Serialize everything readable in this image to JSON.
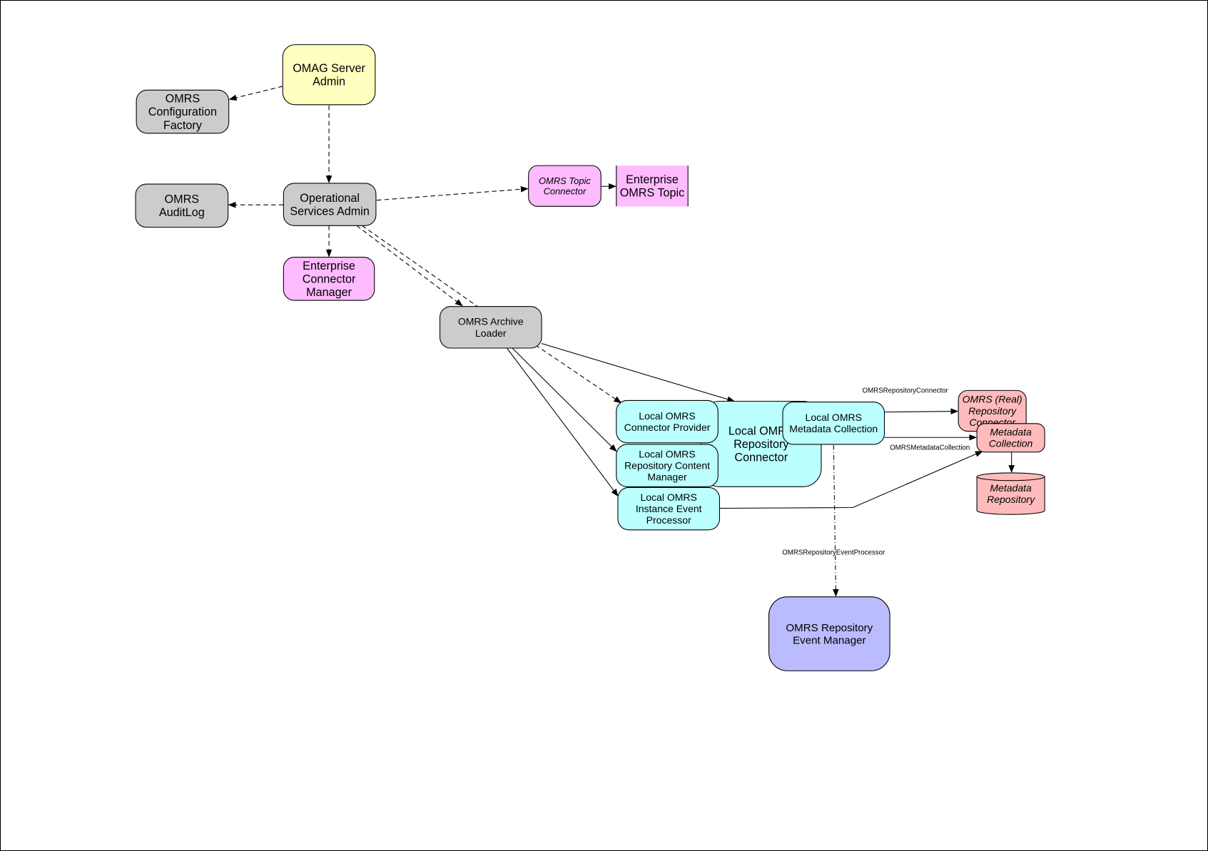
{
  "colors": {
    "admin": "#FFFFC0",
    "grey": "#CCCCCC",
    "enterprise": "#FFBBFF",
    "local": "#BBFFFF",
    "real": "#FFBBBB",
    "event_manager": "#BBBBFF"
  },
  "nodes": {
    "omag_server_admin": [
      "OMAG Server",
      "Admin"
    ],
    "config_factory": [
      "OMRS",
      "Configuration",
      "Factory"
    ],
    "audit_log": [
      "OMRS",
      "AuditLog"
    ],
    "operational_services_admin": [
      "Operational",
      "Services Admin"
    ],
    "enterprise_connector_manager": [
      "Enterprise",
      "Connector",
      "Manager"
    ],
    "topic_connector": [
      "OMRS Topic",
      "Connector"
    ],
    "enterprise_topic": [
      "Enterprise",
      "OMRS Topic"
    ],
    "archive_loader": [
      "OMRS Archive",
      "Loader"
    ],
    "local_repository_connector": [
      "Local OMRS",
      "Repository",
      "Connector"
    ],
    "local_connector_provider": [
      "Local OMRS",
      "Connector Provider"
    ],
    "local_content_manager": [
      "Local OMRS",
      "Repository Content",
      "Manager"
    ],
    "local_event_processor": [
      "Local OMRS",
      "Instance Event",
      "Processor"
    ],
    "local_metadata_collection": [
      "Local OMRS",
      "Metadata Collection"
    ],
    "real_repository_connector": [
      "OMRS (Real)",
      "Repository",
      "Connector"
    ],
    "metadata_collection": [
      "Metadata",
      "Collection"
    ],
    "metadata_repository": [
      "Metadata",
      "Repository"
    ],
    "event_manager": [
      "OMRS Repository",
      "Event Manager"
    ]
  },
  "edge_labels": {
    "repository_connector": "OMRSRepositoryConnector",
    "metadata_collection": "OMRSMetadataCollection",
    "event_processor": "OMRSRepositoryEventProcessor"
  }
}
